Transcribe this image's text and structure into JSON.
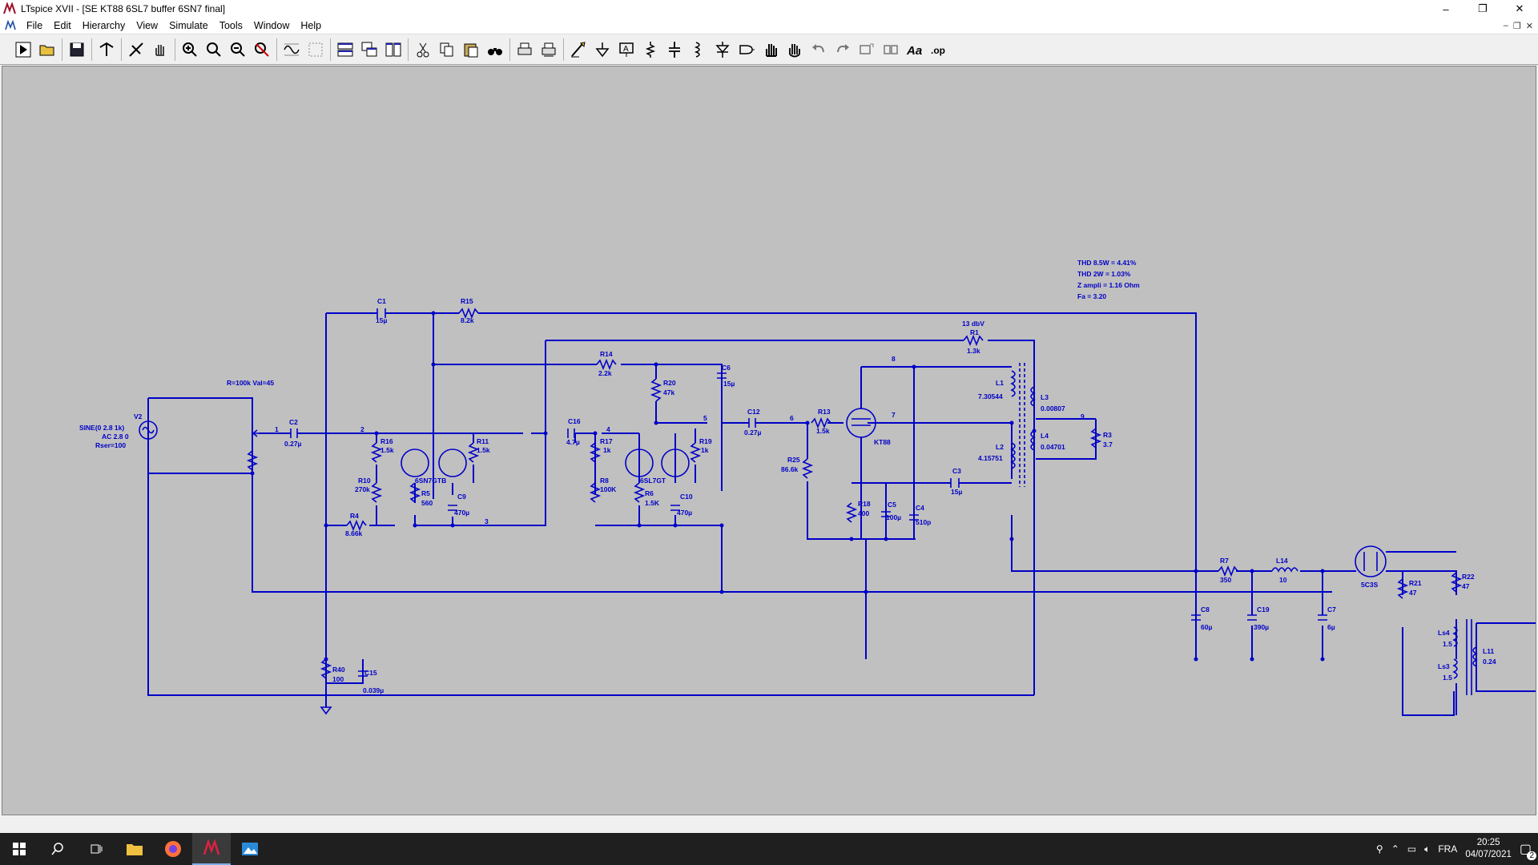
{
  "window": {
    "title": "LTspice XVII - [SE KT88 6SL7 buffer 6SN7 final]",
    "minimize": "–",
    "maximize": "❐",
    "close": "✕"
  },
  "menu": {
    "items": [
      "File",
      "Edit",
      "Hierarchy",
      "View",
      "Simulate",
      "Tools",
      "Window",
      "Help"
    ]
  },
  "toolbar": {
    "icons": [
      "run-icon",
      "open-icon",
      "save-icon",
      "control-panel-icon",
      "halt-icon",
      "pan-icon",
      "zoom-in-icon",
      "zoom-box-icon",
      "zoom-out-icon",
      "zoom-cancel-icon",
      "waveform-icon",
      "autorange-icon",
      "tile-horizontal-icon",
      "cascade-icon",
      "tile-vertical-icon",
      "cut-icon",
      "copy-icon",
      "paste-icon",
      "find-icon",
      "print-icon",
      "print-preview-icon",
      "wire-icon",
      "ground-icon",
      "label-net-icon",
      "resistor-icon",
      "capacitor-icon",
      "inductor-icon",
      "diode-icon",
      "component-icon",
      "move-icon",
      "drag-icon",
      "undo-icon",
      "redo-icon",
      "rotate-icon",
      "mirror-icon",
      "text-icon",
      "spice-directive-icon"
    ]
  },
  "schematic": {
    "colors": {
      "wire": "#0000c8",
      "background": "#c0c0c0"
    },
    "results": [
      "THD 8.5W = 4.41%",
      "THD 2W = 1.03%",
      "Z ampli = 1.16 Ohm",
      "Fa = 3.20"
    ],
    "labels": {
      "level": "13 dbV",
      "pot": "R=100k Val=45",
      "v2_name": "V2",
      "v2_spec1": "SINE(0 2.8 1k)",
      "v2_spec2": "AC 2.8 0",
      "v2_spec3": "Rser=100",
      "c1": "C1",
      "c1v": "15µ",
      "r15": "R15",
      "r15v": "8.2k",
      "r1": "R1",
      "r1v": "1.3k",
      "c2": "C2",
      "c2v": "0.27µ",
      "r16": "R16",
      "r16v": "1.5k",
      "r11": "R11",
      "r11v": "1.5k",
      "tube1": "6SN7GTB",
      "r10": "R10",
      "r10v": "270k",
      "r5": "R5",
      "r5v": "560",
      "c9": "C9",
      "c9v": "470µ",
      "r4": "R4",
      "r4v": "8.66k",
      "r14": "R14",
      "r14v": "2.2k",
      "r20": "R20",
      "r20v": "47k",
      "c6": "C6",
      "c6v": "15µ",
      "c16": "C16",
      "c16v": "4.7µ",
      "r17": "R17",
      "r17v": "1k",
      "r19": "R19",
      "r19v": "1k",
      "tube2": "6SL7GT",
      "r8": "R8",
      "r8v": "100K",
      "r6": "R6",
      "r6v": "1.5K",
      "c10": "C10",
      "c10v": "470µ",
      "c12": "C12",
      "c12v": "0.27µ",
      "r13": "R13",
      "r13v": "1.5k",
      "tube3": "KT88",
      "r25": "R25",
      "r25v": "86.6k",
      "r18": "R18",
      "r18v": "400",
      "c5": "C5",
      "c5v": "100µ",
      "c4": "C4",
      "c4v": "510p",
      "c3": "C3",
      "c3v": "15µ",
      "l1": "L1",
      "l1v": "7.30544",
      "l2": "L2",
      "l2v": "4.15751",
      "l3": "L3",
      "l3v": "0.00807",
      "l4": "L4",
      "l4v": "0.04701",
      "r3": "R3",
      "r3v": "3.7",
      "r7": "R7",
      "r7v": "350",
      "l14": "L14",
      "l14v": "10",
      "tube4": "5C3S",
      "r21": "R21",
      "r21v": "47",
      "r22": "R22",
      "r22v": "47",
      "c8": "C8",
      "c8v": "60µ",
      "c19": "C19",
      "c19v": "390µ",
      "c7": "C7",
      "c7v": "6µ",
      "ls4": "Ls4",
      "ls4v": "1.5",
      "ls3": "Ls3",
      "ls3v": "1.5",
      "l11": "L11",
      "l11v": "0.24",
      "r40": "R40",
      "r40v": "100",
      "c15": "C15",
      "c15v": "0.039µ",
      "n1": "1",
      "n2": "2",
      "n3": "3",
      "n4": "4",
      "n5": "5",
      "n6": "6",
      "n7": "7",
      "n8": "8",
      "n9": "9"
    }
  },
  "taskbar": {
    "language": "FRA",
    "time": "20:25",
    "date": "04/07/2021",
    "notifications": "2"
  }
}
